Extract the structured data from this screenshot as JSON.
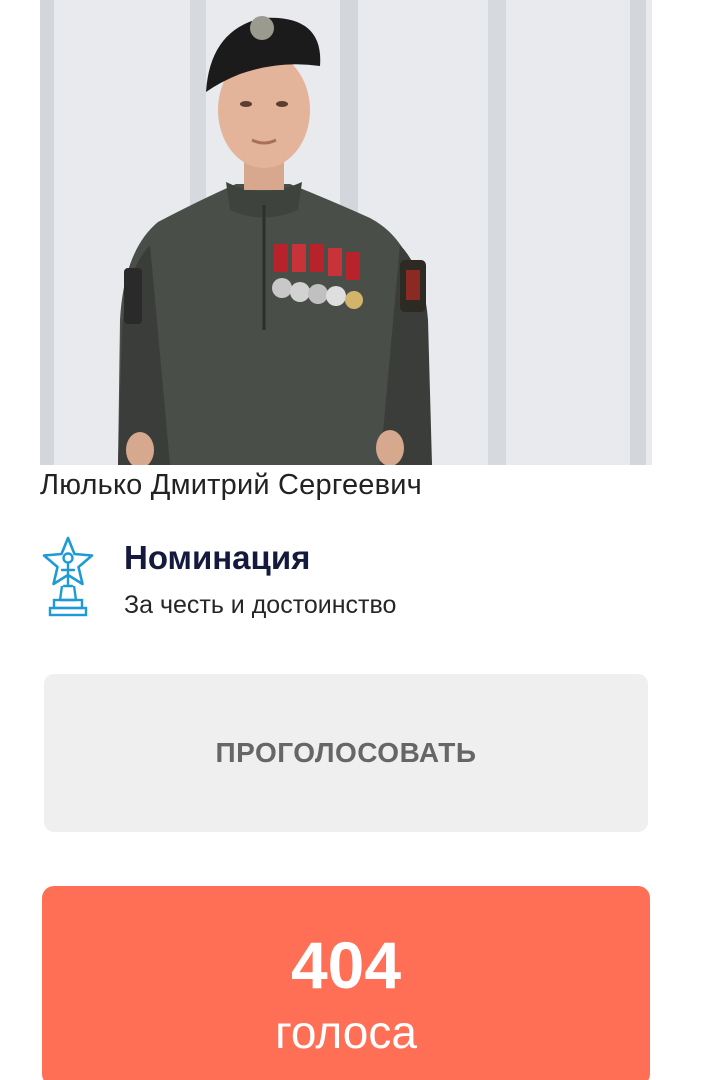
{
  "nominee": {
    "name": "Люлько Дмитрий Сергеевич"
  },
  "nomination": {
    "title": "Номинация",
    "value": "За честь и достоинство",
    "icon": "award-star-trophy-icon"
  },
  "vote_button": {
    "label": "ПРОГОЛОСОВАТЬ"
  },
  "votes": {
    "count": "404",
    "label": "голоса"
  },
  "colors": {
    "accent": "#ff6f56",
    "icon": "#1e9ad6",
    "title": "#141a3e",
    "button_bg": "#efefef",
    "button_text": "#666666"
  }
}
